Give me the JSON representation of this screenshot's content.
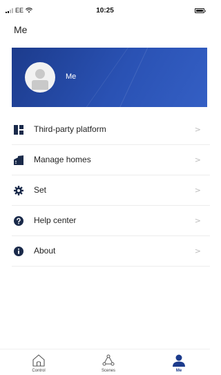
{
  "status_bar": {
    "carrier": "EE",
    "time": "10:25"
  },
  "page": {
    "title": "Me"
  },
  "profile": {
    "name": "Me"
  },
  "menu": {
    "items": [
      {
        "label": "Third-party platform",
        "icon": "grid-icon"
      },
      {
        "label": "Manage homes",
        "icon": "building-icon"
      },
      {
        "label": "Set",
        "icon": "gear-icon"
      },
      {
        "label": "Help center",
        "icon": "question-icon"
      },
      {
        "label": "About",
        "icon": "info-icon"
      }
    ],
    "chevron": ">"
  },
  "tabs": [
    {
      "label": "Control",
      "icon": "home-icon",
      "active": false
    },
    {
      "label": "Scenes",
      "icon": "scenes-icon",
      "active": false
    },
    {
      "label": "Me",
      "icon": "person-icon",
      "active": true
    }
  ],
  "colors": {
    "brand": "#1c3b8c",
    "icon_dark": "#1a2a4a",
    "chevron": "#bdbdbd"
  }
}
